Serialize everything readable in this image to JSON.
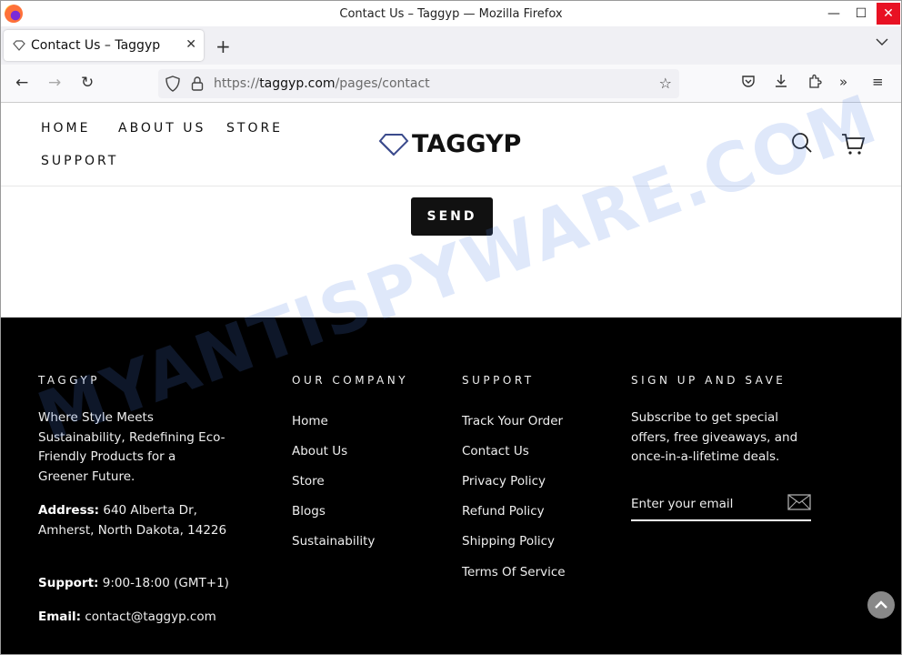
{
  "window": {
    "title": "Contact Us – Taggyp — Mozilla Firefox",
    "minimize_glyph": "—",
    "maximize_glyph": "☐",
    "close_glyph": "✕"
  },
  "tabs": [
    {
      "label": "Contact Us – Taggyp",
      "icon": "diamond-heart-icon",
      "active": true
    }
  ],
  "tabbar": {
    "new_tab_glyph": "+",
    "list_all_glyph": "⌄"
  },
  "navbar": {
    "back_glyph": "←",
    "forward_glyph": "→",
    "reload_glyph": "↻",
    "url_scheme": "https://",
    "url_host": "taggyp.com",
    "url_path": "/pages/contact",
    "bookmark_glyph": "☆",
    "overflow_glyph": "»",
    "menu_glyph": "≡"
  },
  "site_header": {
    "nav": [
      {
        "label": "HOME"
      },
      {
        "label": "ABOUT US"
      },
      {
        "label": "STORE"
      },
      {
        "label": "SUPPORT"
      }
    ],
    "logo_text": "TAGGYP",
    "logo_color": "#3a4a8c"
  },
  "content": {
    "send_button": "SEND"
  },
  "footer": {
    "brand": {
      "heading": "TAGGYP",
      "tagline": "Where Style Meets Sustainability, Redefining Eco-Friendly Products for a Greener Future.",
      "address_label": "Address:",
      "address_line1": "640 Alberta Dr,",
      "address_line2": "Amherst, North Dakota, 14226",
      "support_label": "Support:",
      "support_value": "9:00-18:00 (GMT+1)",
      "email_label": "Email:",
      "email_value": "contact@taggyp.com"
    },
    "company": {
      "heading": "OUR COMPANY",
      "links": [
        "Home",
        "About Us",
        "Store",
        "Blogs",
        "Sustainability"
      ]
    },
    "support": {
      "heading": "SUPPORT",
      "links": [
        "Track Your Order",
        "Contact Us",
        "Privacy Policy",
        "Refund Policy",
        "Shipping Policy",
        "Terms Of Service"
      ]
    },
    "signup": {
      "heading": "SIGN UP AND SAVE",
      "text": "Subscribe to get special offers, free giveaways, and once-in-a-lifetime deals.",
      "email_placeholder": "Enter your email"
    }
  },
  "watermark": "MYANTISPYWARE.COM",
  "colors": {
    "footer_bg": "#000000",
    "button_bg": "#111111",
    "close_red": "#e81123"
  }
}
